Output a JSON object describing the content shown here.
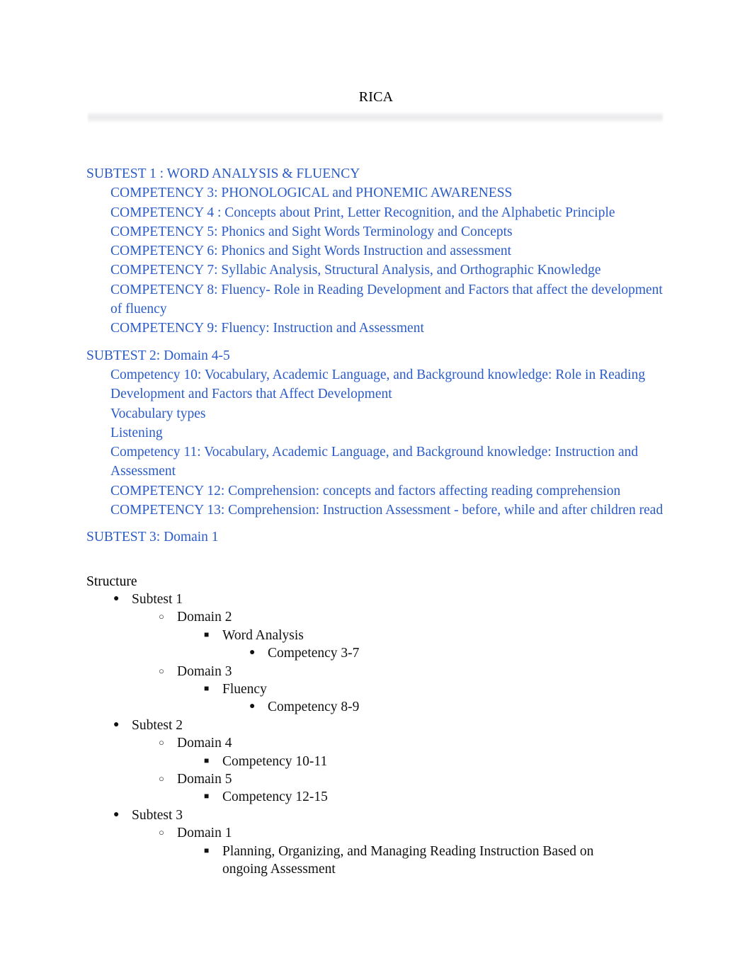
{
  "document": {
    "title": "RICA"
  },
  "outline": {
    "subtest1": {
      "heading": "SUBTEST 1 : WORD ANALYSIS & FLUENCY",
      "items": [
        "COMPETENCY 3: PHONOLOGICAL and PHONEMIC AWARENESS",
        "COMPETENCY 4 : Concepts about Print, Letter Recognition, and the Alphabetic Principle",
        "COMPETENCY 5: Phonics and Sight Words Terminology and Concepts",
        "COMPETENCY 6: Phonics and Sight Words Instruction and assessment",
        "COMPETENCY 7: Syllabic Analysis, Structural Analysis, and Orthographic Knowledge",
        "COMPETENCY 8: Fluency- Role in Reading Development and Factors that affect the development of fluency",
        "COMPETENCY 9: Fluency: Instruction and Assessment"
      ]
    },
    "subtest2": {
      "heading": "SUBTEST 2: Domain 4-5",
      "items": [
        "Competency 10: Vocabulary, Academic Language, and Background knowledge: Role in Reading Development and Factors that Affect Development",
        "Vocabulary types",
        "Listening",
        "Competency 11: Vocabulary, Academic Language, and Background knowledge: Instruction and Assessment",
        "COMPETENCY 12: Comprehension: concepts and factors affecting reading comprehension",
        "COMPETENCY 13: Comprehension: Instruction Assessment - before, while and after children read"
      ]
    },
    "subtest3": {
      "heading": "SUBTEST 3: Domain 1",
      "items": []
    }
  },
  "structure": {
    "heading": "Structure",
    "bullets": {
      "filled_circle": "●",
      "hollow_circle": "○",
      "filled_square": "■"
    },
    "nodes": [
      {
        "label": "Subtest 1"
      },
      {
        "label": "Domain 2"
      },
      {
        "label": "Word Analysis"
      },
      {
        "label": "Competency 3-7"
      },
      {
        "label": "Domain 3"
      },
      {
        "label": "Fluency"
      },
      {
        "label": "Competency 8-9"
      },
      {
        "label": "Subtest 2"
      },
      {
        "label": "Domain 4"
      },
      {
        "label": "Competency 10-11"
      },
      {
        "label": "Domain 5"
      },
      {
        "label": "Competency 12-15"
      },
      {
        "label": "Subtest 3"
      },
      {
        "label": "Domain 1"
      },
      {
        "label": "Planning, Organizing, and Managing Reading Instruction Based on ongoing Assessment"
      }
    ]
  },
  "colors": {
    "heading_blue": "#2a5bc7",
    "body_black": "#000000",
    "page_background": "#ffffff"
  }
}
